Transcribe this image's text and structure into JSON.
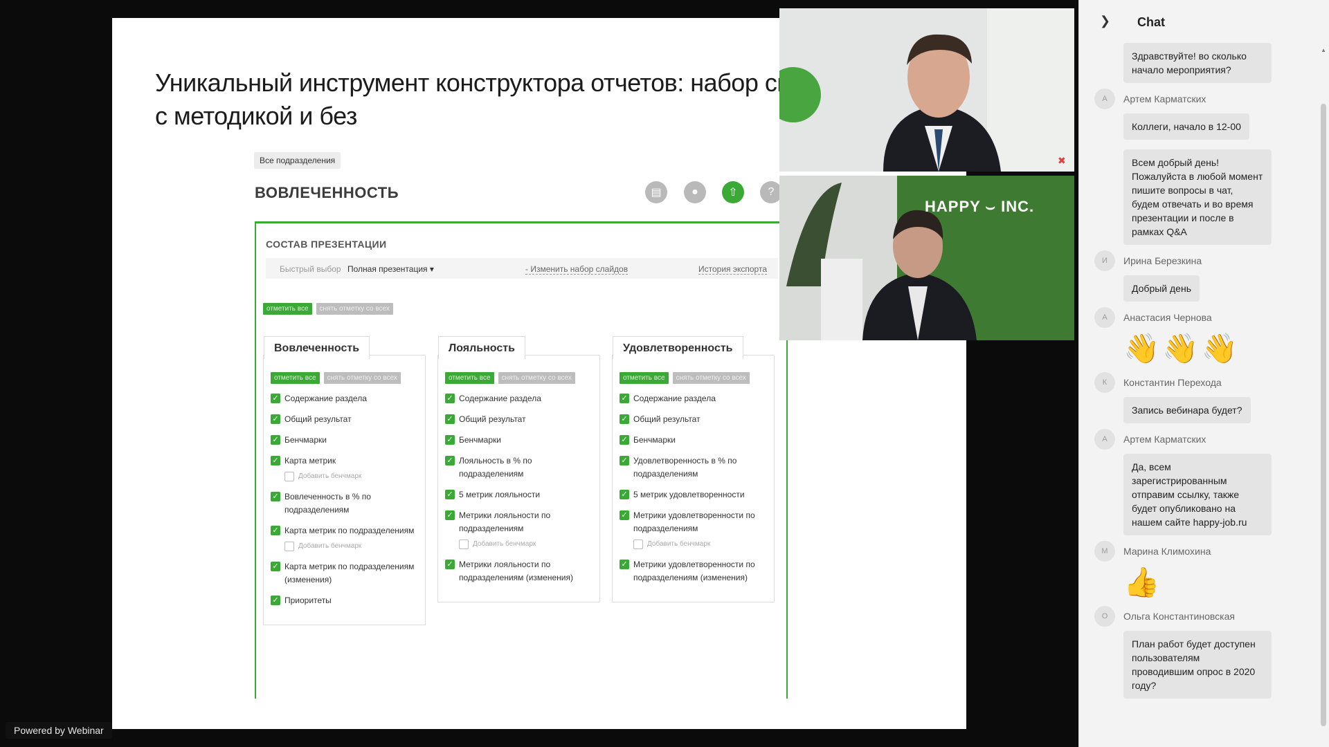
{
  "slide": {
    "title_line1": "Уникальный инструмент конструктора отчетов: набор своих с",
    "title_line2": "с методикой и без",
    "tag": "Все подразделения",
    "section": "ВОВЛЕЧЕННОСТЬ",
    "panel_caption": "СОСТАВ ПРЕЗЕНТАЦИИ",
    "quick_label": "Быстрый выбор",
    "quick_value": "Полная презентация ▾",
    "change_set": "- Изменить набор слайдов",
    "export_history": "История экспорта",
    "select_all": "отметить все",
    "unselect_all": "снять отметку со всех",
    "columns": [
      {
        "title": "Вовлеченность",
        "items": [
          "Содержание раздела",
          "Общий результат",
          "Бенчмарки",
          "Карта метрик",
          "Вовлеченность в % по подразделениям",
          "Карта метрик по подразделениям",
          "Карта метрик по подразделениям (изменения)",
          "Приоритеты"
        ]
      },
      {
        "title": "Лояльность",
        "items": [
          "Содержание раздела",
          "Общий результат",
          "Бенчмарки",
          "Лояльность в % по подразделениям",
          "5 метрик лояльности",
          "Метрики лояльности по подразделениям",
          "Метрики лояльности по подразделениям (изменения)"
        ]
      },
      {
        "title": "Удовлетворенность",
        "items": [
          "Содержание раздела",
          "Общий результат",
          "Бенчмарки",
          "Удовлетворенность в % по подразделениям",
          "5 метрик удовлетворенности",
          "Метрики удовлетворенности по подразделениям",
          "Метрики удовлетворенности по подразделениям (изменения)"
        ]
      }
    ],
    "add_benchmark": "Добавить бенчмарк"
  },
  "video": {
    "logo_text": "HAPPY ⌣ INC."
  },
  "powered_by": "Powered by Webinar",
  "chat": {
    "title": "Chat",
    "messages": [
      {
        "type": "text",
        "author": "",
        "initial": "",
        "text": "Здравствуйте! во сколько начало мероприятия?"
      },
      {
        "type": "text",
        "author": "Артем Карматских",
        "initial": "А",
        "text": "Коллеги, начало в 12-00"
      },
      {
        "type": "text",
        "author": "",
        "initial": "",
        "text": "Всем добрый день! Пожалуйста в любой момент пишите вопросы в чат, будем отвечать и во время презентации и после в рамках Q&A"
      },
      {
        "type": "text",
        "author": "Ирина Березкина",
        "initial": "И",
        "text": "Добрый день"
      },
      {
        "type": "emoji",
        "author": "Анастасия Чернова",
        "initial": "А",
        "text": "👋👋👋"
      },
      {
        "type": "text",
        "author": "Константин Перехода",
        "initial": "К",
        "text": "Запись вебинара будет?"
      },
      {
        "type": "text",
        "author": "Артем Карматских",
        "initial": "А",
        "text": "Да, всем зарегистрированным отправим ссылку, также будет опубликовано на нашем сайте happy-job.ru"
      },
      {
        "type": "emoji",
        "author": "Марина Климохина",
        "initial": "М",
        "text": "👍"
      },
      {
        "type": "text",
        "author": "Ольга Константиновская",
        "initial": "О",
        "text": "План работ будет доступен пользователям проводившим опрос в 2020 году?"
      }
    ]
  },
  "colors": {
    "accent": "#3aa935",
    "chat_bg": "#f3f3f3",
    "bubble": "#e4e4e4"
  }
}
